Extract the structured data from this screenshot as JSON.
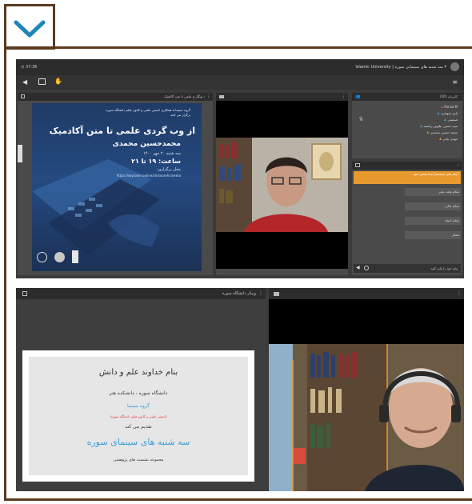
{
  "colors": {
    "frame": "#5c3a1e",
    "chevron": "#1d87b6",
    "conf_bg": "#3b3b3b",
    "conf_bar": "#2c2c2c",
    "accent_orange": "#e89a2e",
    "slide_blue": "#3b9fd6",
    "slide_red": "#d33"
  },
  "header": {
    "chevron": "chevron-down-icon"
  },
  "conf1": {
    "timer": "37:36",
    "room_title": "۳ سه شنبه های سینمایی سوره | Islamic University",
    "slide_panel_title": "ذ ویگار ج علمی تا متن آکاتمیک",
    "slide": {
      "intro": "گروه سینما با همکاری انجمن علمی و کانون فیلم دانشگاه سوره برگزار می کنند",
      "title": "از وب گردی علمی تا متن آکادمیک",
      "presenter": "محمدحسین محمدی",
      "date": "سه شنبه ۲۰ مهر ۱۴۰۰",
      "time": "ساعت: ۱۹ تا ۲۱",
      "venue": "محل برگزاری:",
      "link": "https://skyroom.online/ch/soorehcinema"
    },
    "users_title": "کاربران (10)",
    "users": [
      "Parisa M",
      "پاییز شهبازی",
      "صمیمی",
      "سید حسین نیلوپور رامشه",
      "محمد حسین محمدی",
      "مهدی بیانی"
    ],
    "chat": {
      "notice": "[پیام های سیستم] صدا پخش شود",
      "messages": [
        "سلام وقت بخیر",
        "سلام عالی",
        "سلام استاد",
        "تشکر"
      ],
      "input_placeholder": "پیام خود را وارد کنید"
    }
  },
  "conf2": {
    "slide_panel_title": "وبینار دانشگاه سوره",
    "slide": {
      "line1": "بنام خداوند علم و دانش",
      "line2": "دانشگاه سوره ، دانشکده هنر",
      "line3": "گروه سینما",
      "line4": "(انجمن علمی و کانون فیلم دانشگاه سوره)",
      "line5": "تقدیم می کند",
      "line6": "سه شنبه های سینمای سوره",
      "line7": "مجموعه نشست های پژوهشی"
    }
  }
}
